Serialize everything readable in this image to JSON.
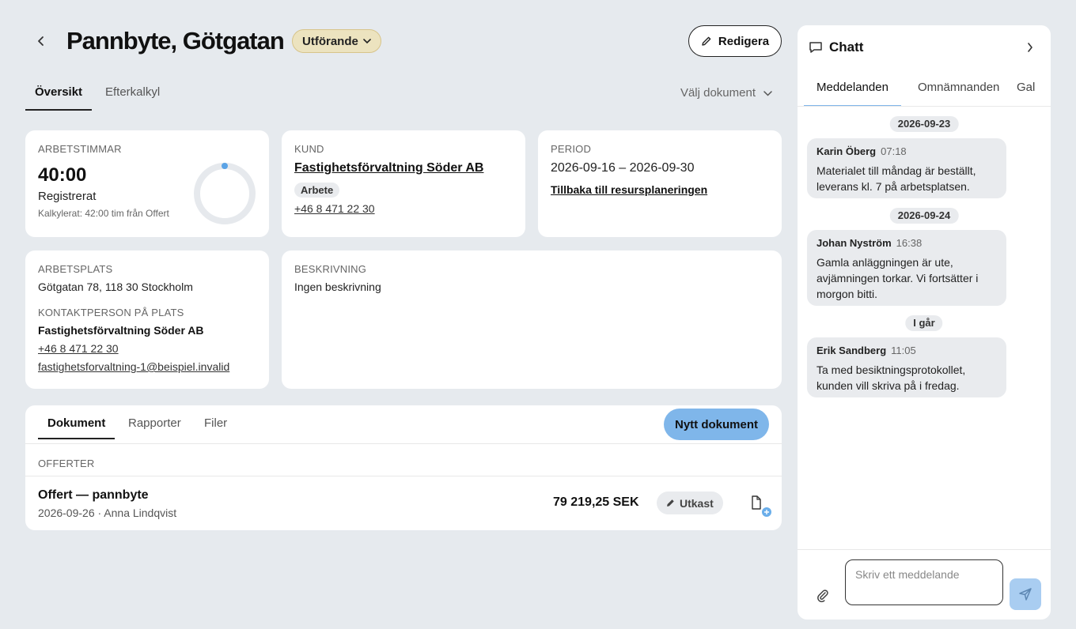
{
  "header": {
    "title": "Pannbyte, Götgatan",
    "status": "Utförande",
    "edit_label": "Redigera"
  },
  "main_tabs": [
    {
      "label": "Översikt",
      "active": true
    },
    {
      "label": "Efterkalkyl",
      "active": false
    }
  ],
  "document_select": "Välj dokument",
  "work_hours": {
    "label": "ARBETSTIMMAR",
    "value": "40:00",
    "status": "Registrerat",
    "calculated": "Kalkylerat: 42:00 tim från Offert",
    "progress_fraction": 0
  },
  "customer": {
    "label": "KUND",
    "name": "Fastighetsförvaltning Söder AB",
    "tag": "Arbete",
    "phone": "+46 8 471 22 30"
  },
  "period": {
    "label": "PERIOD",
    "range": "2026-09-16 – 2026-09-30",
    "link": "Tillbaka till resursplaneringen"
  },
  "workplace": {
    "label": "ARBETSPLATS",
    "address": "Götgatan 78, 118 30 Stockholm",
    "contact_label": "KONTAKTPERSON PÅ PLATS",
    "contact_name": "Fastighetsförvaltning Söder AB",
    "contact_phone": "+46 8 471 22 30",
    "contact_email": "fastighetsforvaltning-1@beispiel.invalid"
  },
  "description": {
    "label": "BESKRIVNING",
    "text": "Ingen beskrivning"
  },
  "documents": {
    "tabs": [
      {
        "label": "Dokument",
        "active": true
      },
      {
        "label": "Rapporter",
        "active": false
      },
      {
        "label": "Filer",
        "active": false
      }
    ],
    "new_label": "Nytt dokument",
    "section_label": "OFFERTER",
    "items": [
      {
        "title": "Offert — pannbyte",
        "meta": "2026-09-26 · Anna Lindqvist",
        "amount": "79 219,25 SEK",
        "status": "Utkast"
      }
    ]
  },
  "chat": {
    "title": "Chatt",
    "tabs": [
      "Meddelanden",
      "Omnämnanden",
      "Gal"
    ],
    "groups": [
      {
        "date": "2026-09-23",
        "messages": [
          {
            "author": "Karin Öberg",
            "time": "07:18",
            "text": "Materialet till måndag är beställt, leverans kl. 7 på arbetsplatsen."
          }
        ]
      },
      {
        "date": "2026-09-24",
        "messages": [
          {
            "author": "Johan Nyström",
            "time": "16:38",
            "text": "Gamla anläggningen är ute, avjämningen torkar. Vi fortsätter i morgon bitti."
          }
        ]
      },
      {
        "date": "I går",
        "messages": [
          {
            "author": "Erik Sandberg",
            "time": "11:05",
            "text": "Ta med besiktningsprotokollet, kunden vill skriva på i fredag."
          }
        ]
      }
    ],
    "input_placeholder": "Skriv ett meddelande"
  },
  "colors": {
    "background": "#e6eaee",
    "status_pill": "#ece3bf",
    "accent_blue": "#7fb6ea"
  }
}
